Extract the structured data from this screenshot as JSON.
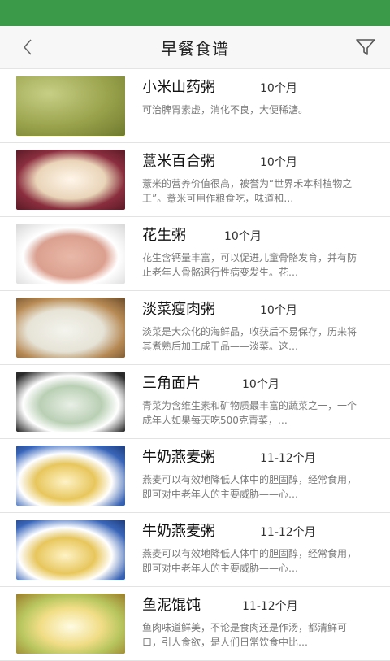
{
  "header": {
    "title": "早餐食谱",
    "back_icon": "chevron-left-icon",
    "filter_icon": "filter-icon"
  },
  "recipes": [
    {
      "name": "小米山药粥",
      "age": "10个月",
      "desc": "可治脾胃素虚，消化不良，大便稀溏。"
    },
    {
      "name": "薏米百合粥",
      "age": "10个月",
      "desc": "薏米的营养价值很高，被誉为“世界禾本科植物之王”。薏米可用作粮食吃，味道和…"
    },
    {
      "name": "花生粥",
      "age": "10个月",
      "desc": "花生含钙量丰富，可以促进儿童骨骼发育，并有防止老年人骨骼退行性病变发生。花…"
    },
    {
      "name": "淡菜瘦肉粥",
      "age": "10个月",
      "desc": "淡菜是大众化的海鲜品，收获后不易保存，历来将其煮熟后加工成干品——淡菜。这…"
    },
    {
      "name": "三角面片",
      "age": "10个月",
      "desc": "青菜为含维生素和矿物质最丰富的蔬菜之一，一个成年人如果每天吃500克青菜，…"
    },
    {
      "name": "牛奶燕麦粥",
      "age": "11-12个月",
      "desc": "燕麦可以有效地降低人体中的胆固醇，经常食用，即可对中老年人的主要威胁——心…"
    },
    {
      "name": "牛奶燕麦粥",
      "age": "11-12个月",
      "desc": "燕麦可以有效地降低人体中的胆固醇，经常食用，即可对中老年人的主要威胁——心…"
    },
    {
      "name": "鱼泥馄饨",
      "age": "11-12个月",
      "desc": "鱼肉味道鲜美，不论是食肉还是作汤，都清鲜可口，引人食欲，是人们日常饮食中比…"
    }
  ]
}
